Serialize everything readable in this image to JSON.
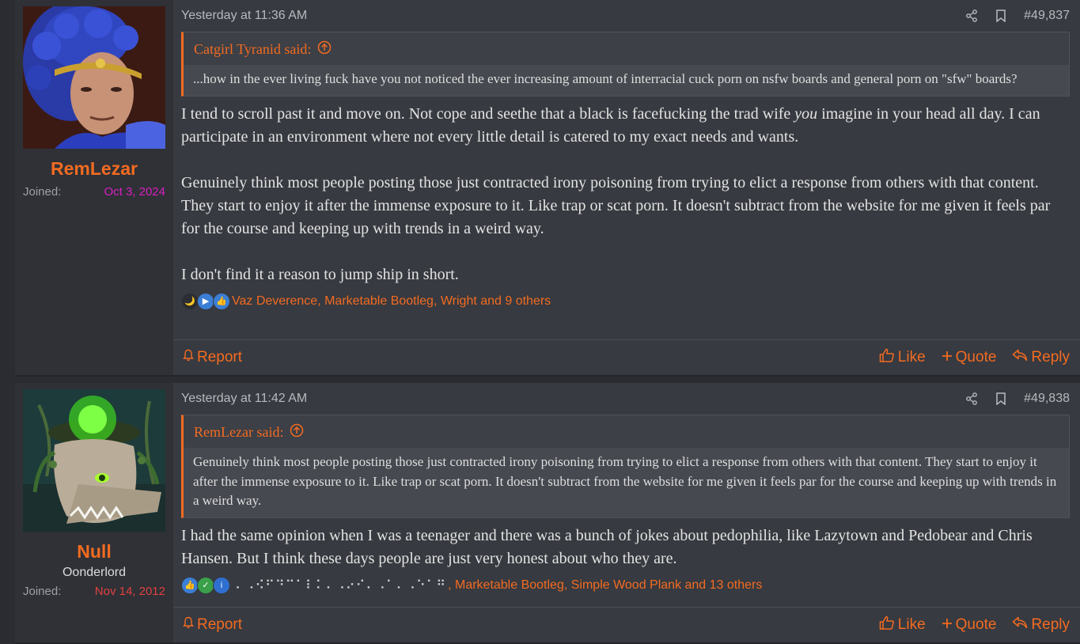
{
  "posts": [
    {
      "user": {
        "name": "RemLezar",
        "title": "",
        "joined_label": "Joined:",
        "joined_date": "Oct 3, 2024",
        "joined_color": "#d91fc1"
      },
      "timestamp": "Yesterday at 11:36 AM",
      "post_number": "#49,837",
      "quote": {
        "author": "Catgirl Tyranid said:",
        "text": "...how in the ever living fuck have you not noticed the ever increasing amount of interracial cuck porn on nsfw boards and general porn on \"sfw\" boards?"
      },
      "message": {
        "p1_before": "I tend to scroll past it and move on. Not cope and seethe that a black is facefucking the trad wife ",
        "p1_em": "you",
        "p1_after": " imagine in your head all day. I can participate in an environment where not every little detail is catered to my exact needs and wants.",
        "p2": "Genuinely think most people posting those just contracted irony poisoning from trying to elict a response from others with that content. They start to enjoy it after the immense exposure to it. Like trap or scat porn. It doesn't subtract from the website for me given it feels par for the course and keeping up with trends in a weird way.",
        "p3": "I don't find it a reason to jump ship in short."
      },
      "reactions": {
        "text": "Vaz Deverence, Marketable Bootleg, Wright and 9 others"
      },
      "footer": {
        "report": "Report",
        "like": "Like",
        "quote": "Quote",
        "reply": "Reply"
      }
    },
    {
      "user": {
        "name": "Null",
        "title": "Oonderlord",
        "joined_label": "Joined:",
        "joined_date": "Nov 14, 2012",
        "joined_color": "#e04040"
      },
      "timestamp": "Yesterday at 11:42 AM",
      "post_number": "#49,838",
      "quote": {
        "author": "RemLezar said:",
        "text": "Genuinely think most people posting those just contracted irony poisoning from trying to elict a response from others with that content. They start to enjoy it after the immense exposure to it. Like trap or scat porn. It doesn't subtract from the website for me given it feels par for the course and keeping up with trends in a weird way."
      },
      "message": {
        "p1": "I had the same opinion when I was a teenager and there was a bunch of jokes about pedophilia, like Lazytown and Pedobear and Chris Hansen. But I think these days people are just very honest about who they are."
      },
      "reactions": {
        "braille": "⠄⠠⠪⠋⠙⠉⠁⠇⠅⠄⠠⠔⠊⠄⠠⠁⠄⠠⠑⠁⠛",
        "text": ", Marketable Bootleg, Simple Wood Plank and 13 others"
      },
      "footer": {
        "report": "Report",
        "like": "Like",
        "quote": "Quote",
        "reply": "Reply"
      }
    }
  ],
  "colors": {
    "accent": "#f36b21",
    "background": "#373a40",
    "user_cell": "#2f3136"
  }
}
